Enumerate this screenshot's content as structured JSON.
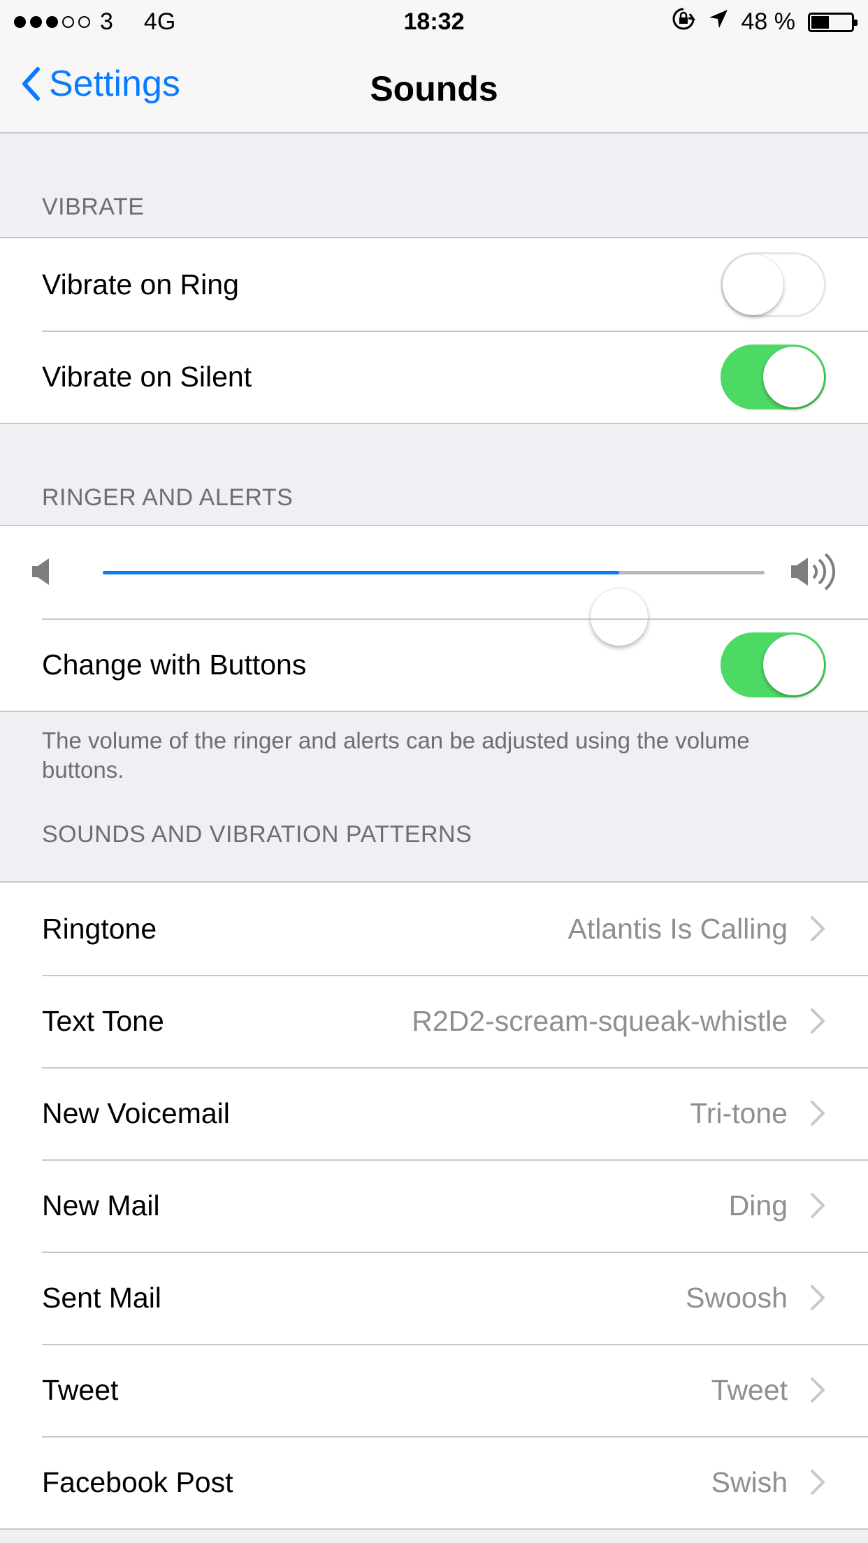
{
  "status_bar": {
    "signal_bars_filled": 3,
    "signal_bars_total": 5,
    "carrier": "3",
    "network": "4G",
    "time": "18:32",
    "battery_percent_text": "48 %",
    "battery_level": 0.48,
    "icons": [
      "orientation-lock-icon",
      "location-arrow-icon",
      "battery-icon"
    ]
  },
  "nav": {
    "back_label": "Settings",
    "title": "Sounds"
  },
  "vibrate": {
    "header": "VIBRATE",
    "rows": [
      {
        "label": "Vibrate on Ring",
        "on": false
      },
      {
        "label": "Vibrate on Silent",
        "on": true
      }
    ]
  },
  "ringer": {
    "header": "RINGER AND ALERTS",
    "volume_level": 0.78,
    "change_with_buttons_label": "Change with Buttons",
    "change_with_buttons_on": true,
    "footer": "The volume of the ringer and alerts can be adjusted using the volume buttons."
  },
  "sounds": {
    "header": "SOUNDS AND VIBRATION PATTERNS",
    "rows": [
      {
        "label": "Ringtone",
        "value": "Atlantis Is Calling"
      },
      {
        "label": "Text Tone",
        "value": "R2D2-scream-squeak-whistle"
      },
      {
        "label": "New Voicemail",
        "value": "Tri-tone"
      },
      {
        "label": "New Mail",
        "value": "Ding"
      },
      {
        "label": "Sent Mail",
        "value": "Swoosh"
      },
      {
        "label": "Tweet",
        "value": "Tweet"
      },
      {
        "label": "Facebook Post",
        "value": "Swish"
      }
    ]
  },
  "colors": {
    "accent": "#0a7aff",
    "toggle_on": "#4cd964",
    "secondary_text": "#8e8e93",
    "group_background": "#efeff4"
  }
}
